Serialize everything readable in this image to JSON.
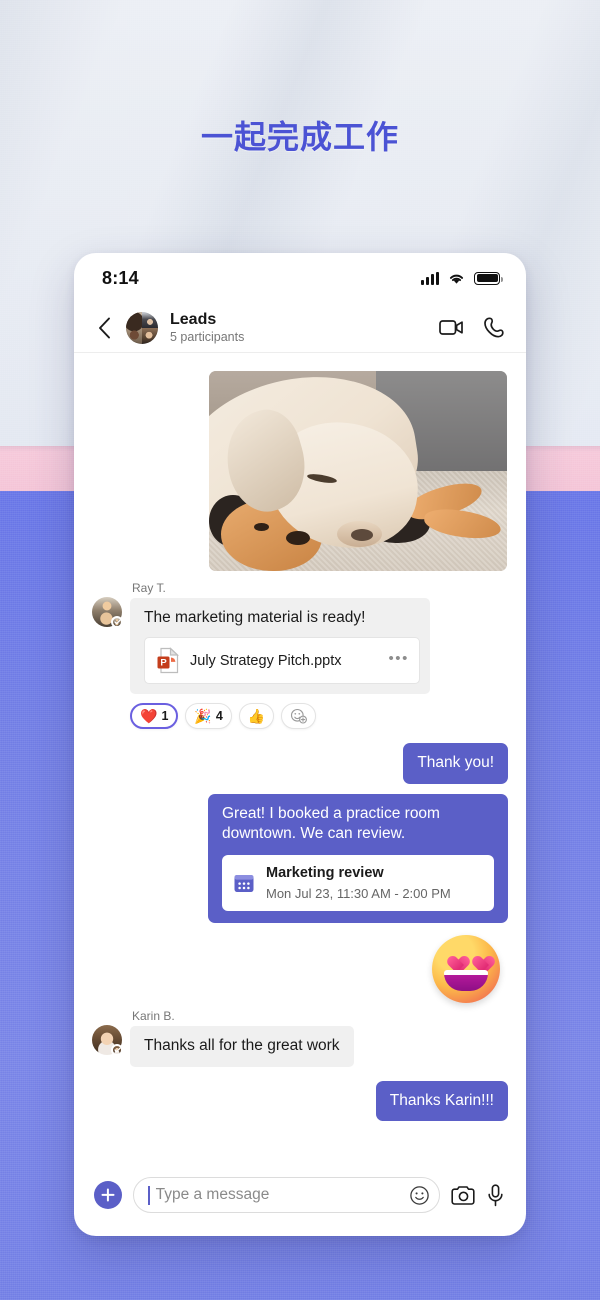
{
  "page": {
    "headline": "一起完成工作",
    "headline_color": "#4b53d4",
    "background": {
      "top_band_color": "#eceff5",
      "pink_band_color": "#f5c7d9",
      "blue_band_color": "#7480e6"
    }
  },
  "phone": {
    "statusbar": {
      "time": "8:14",
      "icons": [
        "signal-bars-icon",
        "wifi-icon",
        "battery-icon"
      ]
    },
    "header": {
      "back_icon": "chevron-left-icon",
      "avatar": "group-avatar",
      "title": "Leads",
      "subtitle": "5 participants",
      "actions": [
        {
          "name": "video-call-button",
          "icon": "video-camera-icon"
        },
        {
          "name": "audio-call-button",
          "icon": "phone-handset-icon"
        }
      ]
    },
    "accent_color": "#5b5fc7",
    "messages": [
      {
        "type": "image",
        "direction": "outgoing",
        "alt": "Yellow labrador dog sleeping on a plush toy"
      },
      {
        "type": "text-with-file",
        "direction": "incoming",
        "sender": "Ray T.",
        "presence": "available",
        "text": "The marketing material is ready!",
        "file": {
          "name": "July Strategy Pitch.pptx",
          "icon": "powerpoint-file-icon",
          "menu_icon": "more-options-icon"
        },
        "reactions": [
          {
            "emoji": "❤️",
            "name": "heart-reaction",
            "count": "1",
            "selected": true
          },
          {
            "emoji": "🎉",
            "name": "laugh-reaction",
            "count": "4",
            "selected": false
          },
          {
            "emoji": "👍",
            "name": "thumbs-up-reaction",
            "count": "",
            "selected": false
          },
          {
            "emoji": "",
            "name": "add-reaction-button",
            "count": "",
            "selected": false
          }
        ]
      },
      {
        "type": "text",
        "direction": "outgoing",
        "text": "Thank you!"
      },
      {
        "type": "text-with-event",
        "direction": "outgoing",
        "text": "Great! I booked a practice room downtown. We can review.",
        "event": {
          "icon": "calendar-icon",
          "title": "Marketing review",
          "subtitle": "Mon Jul 23, 11:30 AM - 2:00 PM"
        }
      },
      {
        "type": "sticker",
        "direction": "outgoing",
        "name": "heart-eyes-emoji-sticker"
      },
      {
        "type": "text",
        "direction": "incoming",
        "sender": "Karin B.",
        "presence": "available",
        "text": "Thanks all for the great work"
      },
      {
        "type": "text",
        "direction": "outgoing",
        "text": "Thanks Karin!!!"
      }
    ],
    "composer": {
      "add_button": "+",
      "placeholder": "Type a message",
      "value": "",
      "emoji_icon": "emoji-smiley-icon",
      "camera_icon": "camera-icon",
      "mic_icon": "microphone-icon"
    }
  }
}
